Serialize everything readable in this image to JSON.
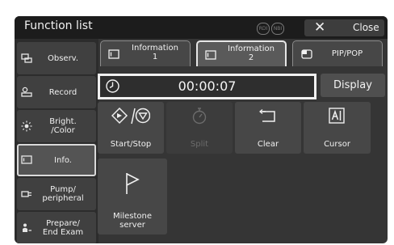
{
  "window": {
    "title": "Function list",
    "close_label": "Close",
    "mode_badges": [
      "RDI",
      "NBI"
    ]
  },
  "sidebar": {
    "items": [
      {
        "label": "Observ.",
        "icon": "observation-icon"
      },
      {
        "label": "Record",
        "icon": "record-icon"
      },
      {
        "label": "Bright.\n/Color",
        "icon": "brightness-icon"
      },
      {
        "label": "Info.",
        "icon": "info-icon",
        "active": true
      },
      {
        "label": "Pump/\nperipheral",
        "icon": "pump-icon"
      },
      {
        "label": "Prepare/\nEnd Exam",
        "icon": "prepare-exam-icon"
      }
    ]
  },
  "tabs": [
    {
      "label": "Information\n1",
      "icon": "monitor-icon"
    },
    {
      "label": "Information\n2",
      "icon": "monitor-icon",
      "active": true
    },
    {
      "label": "PIP/POP",
      "icon": "pip-icon"
    }
  ],
  "timer": {
    "value": "00:00:07",
    "icon": "clock-icon"
  },
  "display_button": "Display",
  "functions": [
    {
      "label": "Start/Stop",
      "icon": "start-stop-icon",
      "enabled": true
    },
    {
      "label": "Split",
      "icon": "stopwatch-icon",
      "enabled": false
    },
    {
      "label": "Clear",
      "icon": "clear-icon",
      "enabled": true
    },
    {
      "label": "Cursor",
      "icon": "cursor-icon",
      "enabled": true
    }
  ],
  "milestone": {
    "label": "Milestone\nserver",
    "icon": "flag-icon"
  },
  "colors": {
    "background": "#353535",
    "titlebar": "#1c1c1c",
    "button": "#474747",
    "highlight": "#f0f0f0"
  }
}
